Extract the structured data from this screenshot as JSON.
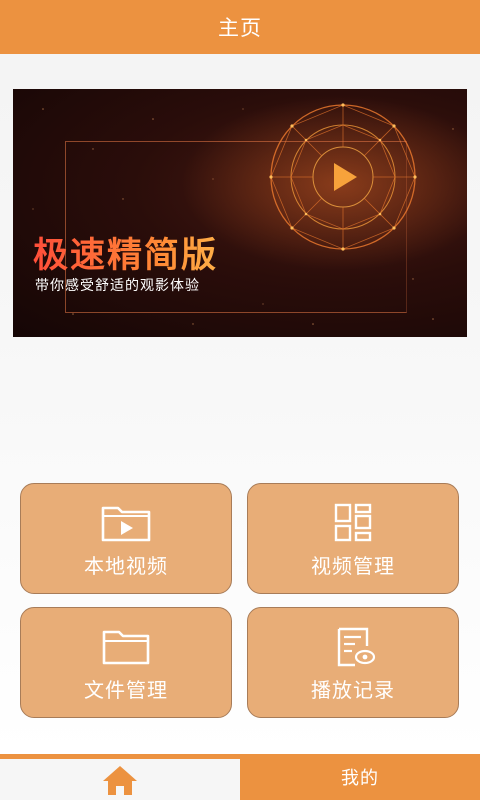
{
  "header": {
    "title": "主页"
  },
  "banner": {
    "headline": "极速精简版",
    "slogan": "带你感受舒适的观影体验"
  },
  "menu": {
    "items": [
      {
        "label": "本地视频",
        "icon": "folder-video-icon"
      },
      {
        "label": "视频管理",
        "icon": "grid-icon"
      },
      {
        "label": "文件管理",
        "icon": "folder-icon"
      },
      {
        "label": "播放记录",
        "icon": "document-eye-icon"
      }
    ]
  },
  "tabbar": {
    "home_icon": "home-icon",
    "mine_label": "我的"
  },
  "colors": {
    "accent": "#ec9240",
    "tile": "#e8ad77",
    "tile_border": "#a87c58"
  }
}
